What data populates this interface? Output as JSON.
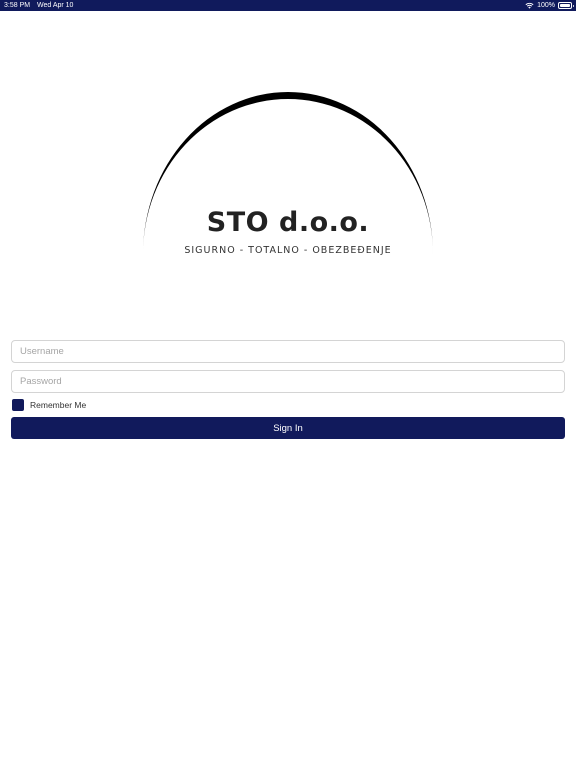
{
  "status_bar": {
    "time": "3:58 PM",
    "date": "Wed Apr 10",
    "battery": "100%",
    "wifi_icon": "wifi-icon",
    "battery_icon": "battery-icon"
  },
  "logo": {
    "company_name": "STO d.o.o.",
    "tagline": "SIGURNO - TOTALNO - OBEZBEĐENJE"
  },
  "login": {
    "username_placeholder": "Username",
    "password_placeholder": "Password",
    "remember_label": "Remember Me",
    "remember_checked": true,
    "signin_label": "Sign In"
  },
  "colors": {
    "brand": "#111a5c",
    "status_bar": "#101a5c",
    "field_border": "#d4d4d4",
    "placeholder": "#a5a5a5",
    "logo_arc": "#000000"
  }
}
